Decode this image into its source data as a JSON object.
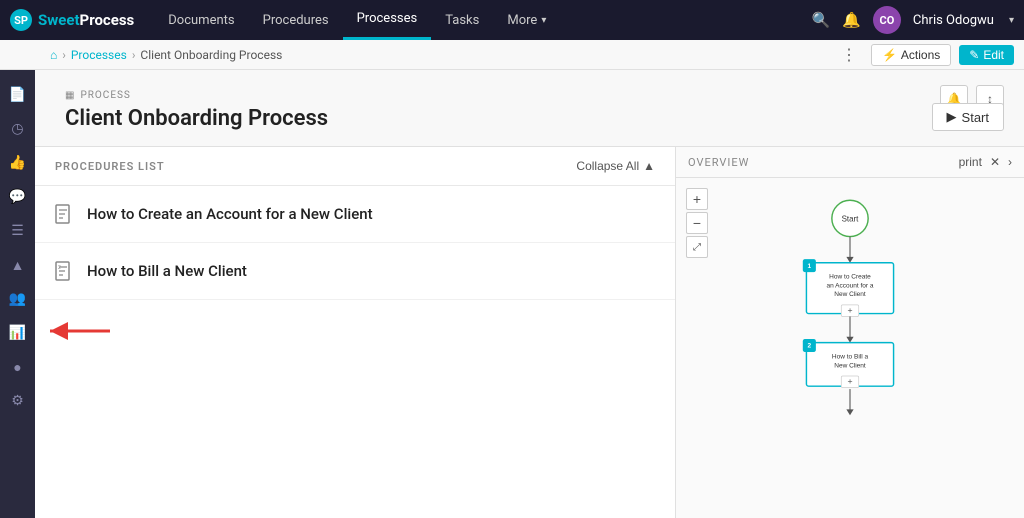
{
  "topnav": {
    "logo_sweet": "Sweet",
    "logo_process": "Process",
    "links": [
      {
        "label": "Documents",
        "active": false
      },
      {
        "label": "Procedures",
        "active": false
      },
      {
        "label": "Processes",
        "active": true
      },
      {
        "label": "Tasks",
        "active": false
      },
      {
        "label": "More",
        "active": false,
        "dropdown": true
      }
    ],
    "search_icon": "🔍",
    "bell_icon": "🔔",
    "user_initials": "CO",
    "user_name": "Chris Odogwu",
    "user_chevron": "▾"
  },
  "breadcrumb": {
    "home_icon": "⌂",
    "processes_label": "Processes",
    "current": "Client Onboarding Process",
    "dots": "⋮",
    "actions_label": "Actions",
    "actions_icon": "⚡",
    "edit_label": "Edit",
    "edit_icon": "✎"
  },
  "sidebar": {
    "icons": [
      {
        "name": "document-icon",
        "symbol": "📄"
      },
      {
        "name": "clock-icon",
        "symbol": "◷"
      },
      {
        "name": "thumbs-icon",
        "symbol": "👍"
      },
      {
        "name": "chat-icon",
        "symbol": "💬"
      },
      {
        "name": "list-icon",
        "symbol": "☰"
      },
      {
        "name": "arrow-icon",
        "symbol": "▲"
      },
      {
        "name": "team-icon",
        "symbol": "👥"
      },
      {
        "name": "chart-icon",
        "symbol": "📊"
      },
      {
        "name": "dot-icon",
        "symbol": "●"
      },
      {
        "name": "settings-icon",
        "symbol": "⚙"
      }
    ]
  },
  "process": {
    "label": "PROCESS",
    "label_icon": "▦",
    "title": "Client Onboarding Process",
    "start_label": "Start",
    "start_icon": "▶"
  },
  "procedures_list": {
    "header": "PROCEDURES LIST",
    "collapse_all": "Collapse All",
    "collapse_icon": "▲",
    "items": [
      {
        "id": 1,
        "name": "How to Create an Account for a New Client"
      },
      {
        "id": 2,
        "name": "How to Bill a New Client"
      }
    ]
  },
  "overview": {
    "header": "OVERVIEW",
    "print_label": "print",
    "close_icon": "✕",
    "next_icon": "›",
    "zoom_plus": "+",
    "zoom_minus": "−",
    "zoom_fit": "⤢",
    "nodes": {
      "start_label": "Start",
      "step1_badge": "1",
      "step1_label": "How to Create an Account for a New Client",
      "step2_badge": "2",
      "step2_label": "How to Bill a New Client"
    }
  }
}
